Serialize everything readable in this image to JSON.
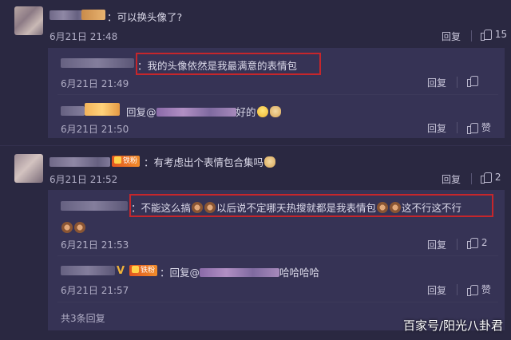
{
  "comments": [
    {
      "text": "：可以换头像了?",
      "time": "6月21日 21:48",
      "reply_label": "回复",
      "likes": "15"
    },
    {
      "text": "：有考虑出个表情包合集吗",
      "badge": "铁粉",
      "time": "6月21日 21:52",
      "reply_label": "回复",
      "likes": "2"
    }
  ],
  "replies_a": [
    {
      "text": "：我的头像依然是我最满意的表情包",
      "time": "6月21日 21:49",
      "reply_label": "回复",
      "likes": ""
    },
    {
      "prefix": "回复@",
      "text": "好的",
      "time": "6月21日 21:50",
      "reply_label": "回复",
      "likes": "赞"
    }
  ],
  "replies_b": [
    {
      "text_1": "：不能这么搞",
      "text_2": "以后说不定哪天热搜就都是我表情包",
      "text_3": "这不行这不行",
      "time": "6月21日 21:53",
      "reply_label": "回复",
      "likes": "2"
    },
    {
      "badge": "铁粉",
      "prefix": "：回复@",
      "text": "哈哈哈哈",
      "time": "6月21日 21:57",
      "reply_label": "回复",
      "likes": "赞"
    }
  ],
  "more_replies": "共3条回复",
  "watermark": "百家号/阳光八卦君"
}
